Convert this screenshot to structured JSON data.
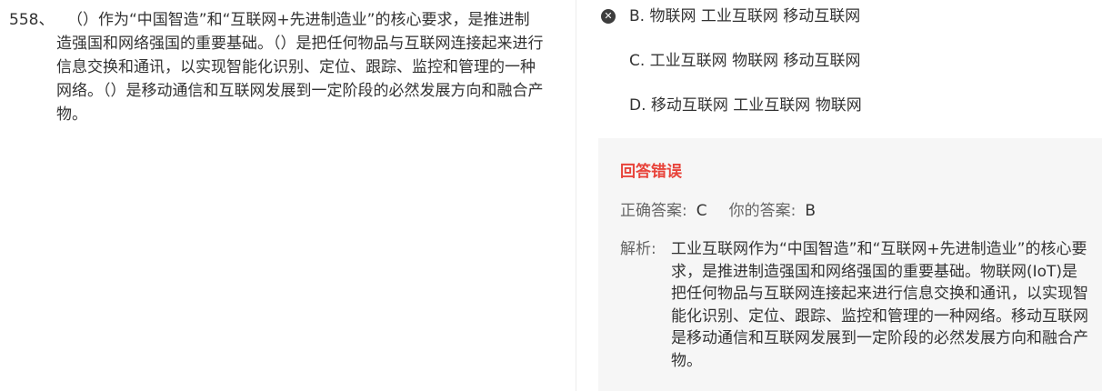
{
  "question": {
    "number": "558、",
    "text": "（）作为“中国智造”和“互联网+先进制造业”的核心要求，是推进制造强国和网络强国的重要基础。（）是把任何物品与互联网连接起来进行信息交换和通讯，以实现智能化识别、定位、跟踪、监控和管理的一种网络。（）是移动通信和互联网发展到一定阶段的必然发展方向和融合产物。"
  },
  "options": [
    {
      "label": "B. 物联网  工业互联网  移动互联网",
      "icon": "wrong-mark-icon"
    },
    {
      "label": "C. 工业互联网  物联网  移动互联网"
    },
    {
      "label": "D. 移动互联网  工业互联网  物联网"
    }
  ],
  "feedback": {
    "title": "回答错误",
    "correct_label": "正确答案:",
    "correct_value": "C",
    "yours_label": "你的答案:",
    "yours_value": "B",
    "analysis_label": "解析:",
    "analysis_text": "工业互联网作为“中国智造”和“互联网+先进制造业”的核心要求，是推进制造强国和网络强国的重要基础。物联网(IoT)是把任何物品与互联网连接起来进行信息交换和通讯，以实现智能化识别、定位、跟踪、监控和管理的一种网络。移动互联网是移动通信和互联网发展到一定阶段的必然发展方向和融合产物。"
  },
  "colors": {
    "error_red": "#e8433a",
    "panel_bg": "#f6f6f6",
    "icon_dark": "#3d3d3d"
  }
}
